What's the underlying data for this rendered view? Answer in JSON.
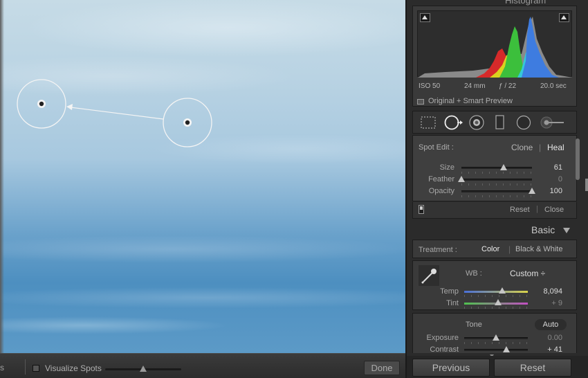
{
  "toolbar": {
    "left_cut_label": "s",
    "visualize_label": "Visualize Spots",
    "visualize_slider_value": 0.5,
    "done_label": "Done"
  },
  "histogram": {
    "title": "Histogram",
    "iso": "ISO 50",
    "focal": "24 mm",
    "aperture": "ƒ / 22",
    "shutter": "20.0 sec",
    "preview_label": "Original + Smart Preview"
  },
  "tools": [
    {
      "name": "crop-overlay-icon"
    },
    {
      "name": "spot-removal-icon"
    },
    {
      "name": "red-eye-icon"
    },
    {
      "name": "graduated-filter-icon"
    },
    {
      "name": "radial-filter-icon"
    },
    {
      "name": "adjustment-brush-icon"
    }
  ],
  "spot_edit": {
    "label": "Spot Edit :",
    "clone_label": "Clone",
    "separator": "|",
    "heal_label": "Heal",
    "rows": [
      {
        "label": "Size",
        "value": "61",
        "level": 0.6
      },
      {
        "label": "Feather",
        "value": "0",
        "level": 0.0
      },
      {
        "label": "Opacity",
        "value": "100",
        "level": 1.0
      }
    ],
    "reset_label": "Reset",
    "close_label": "Close"
  },
  "basic": {
    "header": "Basic",
    "treatment_label": "Treatment :",
    "color_label": "Color",
    "separator": "|",
    "bw_label": "Black & White",
    "wb_label": "WB :",
    "wb_value": "Custom ÷",
    "temp": {
      "label": "Temp",
      "value": "8,094",
      "level": 0.6
    },
    "tint": {
      "label": "Tint",
      "value": "+ 9",
      "level": 0.53
    },
    "tone_label": "Tone",
    "auto_label": "Auto",
    "exposure": {
      "label": "Exposure",
      "value": "0.00",
      "level": 0.5
    },
    "contrast": {
      "label": "Contrast",
      "value": "+ 41",
      "level": 0.66
    }
  },
  "buttons": {
    "previous_label": "Previous",
    "reset_label": "Reset"
  },
  "colors": {
    "sky_light": "#c6dbe6",
    "sky_dark": "#4d8fc0",
    "panel_bg": "#2b2b2b",
    "temp_track_left": "#4a6fd8",
    "temp_track_right": "#d8d24a",
    "tint_track_left": "#4fc24f",
    "tint_track_right": "#c24fc2"
  }
}
